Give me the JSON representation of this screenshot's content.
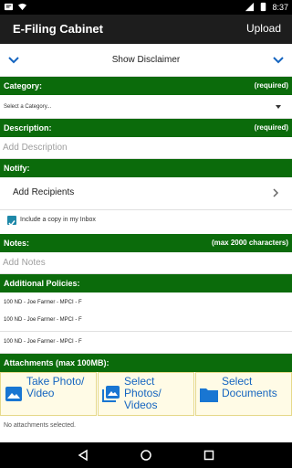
{
  "status_bar": {
    "time": "8:37"
  },
  "app_bar": {
    "title": "E-Filing Cabinet",
    "upload_label": "Upload"
  },
  "disclaimer": {
    "label": "Show Disclaimer"
  },
  "category": {
    "header": "Category:",
    "required": "(required)",
    "selected": "Select a Category..."
  },
  "description": {
    "header": "Description:",
    "required": "(required)",
    "placeholder": "Add Description"
  },
  "notify": {
    "header": "Notify:",
    "add_recipients": "Add Recipients",
    "copy_inbox_label": "Include a copy in my Inbox",
    "copy_inbox_checked": true
  },
  "notes": {
    "header": "Notes:",
    "limit": "(max 2000 characters)",
    "placeholder": "Add Notes"
  },
  "policies": {
    "header": "Additional Policies:",
    "items": [
      "100 ND - Joe Farmer - MPCI - F",
      "100 ND - Joe Farmer - MPCI - F",
      "100 ND - Joe Farmer - MPCI - F"
    ]
  },
  "attachments": {
    "header": "Attachments (max 100MB):",
    "take_photo": "Take Photo/ Video",
    "select_photos": "Select Photos/ Videos",
    "select_documents": "Select Documents",
    "empty_text": "No attachments selected."
  },
  "colors": {
    "section_green": "#0b6b0b",
    "link_blue": "#1565c0",
    "checkbox_teal": "#1e88a8",
    "button_bg": "#fffbe6"
  }
}
